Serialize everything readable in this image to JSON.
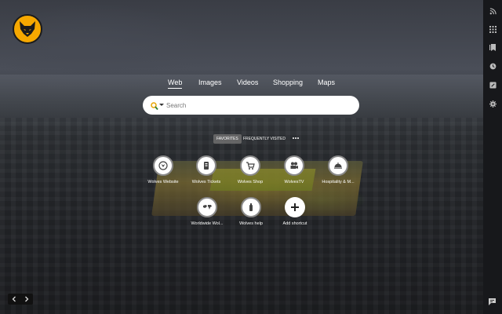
{
  "search": {
    "tabs": [
      {
        "label": "Web",
        "active": true
      },
      {
        "label": "Images",
        "active": false
      },
      {
        "label": "Videos",
        "active": false
      },
      {
        "label": "Shopping",
        "active": false
      },
      {
        "label": "Maps",
        "active": false
      }
    ],
    "placeholder": "Search",
    "value": ""
  },
  "filters": {
    "favorites": "FAVORITES",
    "frequently_visited": "FREQUENTLY VISITED",
    "active": "FAVORITES"
  },
  "shortcuts": [
    {
      "label": "Wolves Website",
      "icon": "wolves-crest-icon"
    },
    {
      "label": "Wolves Tickets",
      "icon": "ticket-icon"
    },
    {
      "label": "Wolves Shop",
      "icon": "shopping-cart-icon"
    },
    {
      "label": "WolvesTV",
      "icon": "tv-camera-icon"
    },
    {
      "label": "Hospitality & M...",
      "icon": "cloche-icon"
    },
    {
      "label": "Worldwide Wol...",
      "icon": "world-map-icon"
    },
    {
      "label": "Wolves help",
      "icon": "help-bottle-icon"
    },
    {
      "label": "Add shortcut",
      "icon": "plus-icon"
    }
  ],
  "sidebar": {
    "icons": [
      "rss-icon",
      "apps-grid-icon",
      "bookmarks-icon",
      "history-icon",
      "edit-notes-icon",
      "settings-gear-icon"
    ]
  },
  "colors": {
    "accent": "#f6a800",
    "sidebar_bg": "#17181b",
    "pill_active": "#6e6e6e"
  }
}
